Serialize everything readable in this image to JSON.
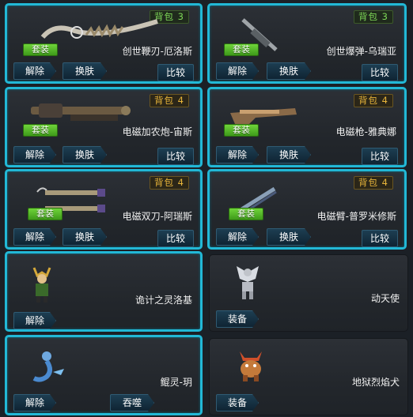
{
  "buttons": {
    "unequip": "解除",
    "reskin": "换肤",
    "compare": "比较",
    "equip": "装备",
    "devour": "吞噬"
  },
  "suit_label": "套装",
  "items": [
    {
      "name": "创世鞭刃-厄洛斯",
      "bag": "背包 3",
      "icon": "whip-blade-icon"
    },
    {
      "name": "创世爆弹-乌瑞亚",
      "bag": "背包 3",
      "icon": "bomb-launcher-icon"
    },
    {
      "name": "电磁加农炮-宙斯",
      "bag": "背包 4",
      "icon": "cannon-icon"
    },
    {
      "name": "电磁枪-雅典娜",
      "bag": "背包 4",
      "icon": "rifle-icon"
    },
    {
      "name": "电磁双刀-阿瑞斯",
      "bag": "背包 4",
      "icon": "twin-blades-icon"
    },
    {
      "name": "电磁臂-普罗米修斯",
      "bag": "背包 4",
      "icon": "arm-cannon-icon"
    }
  ],
  "spirits": [
    {
      "name": "诡计之灵洛基",
      "icon": "loki-spirit-icon"
    },
    {
      "name": "动天使",
      "icon": "mecha-angel-icon"
    },
    {
      "name": "鲲灵-玥",
      "icon": "kun-spirit-icon"
    },
    {
      "name": "地狱烈焰犬",
      "icon": "hellhound-icon"
    }
  ],
  "colors": {
    "selected_border": "#22b8d6",
    "bag3": "#7ed957",
    "bag4": "#e8b53a",
    "suit": "#4fb526"
  }
}
